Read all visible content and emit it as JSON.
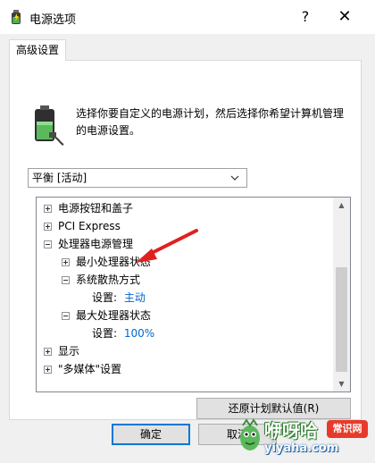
{
  "window": {
    "title": "电源选项",
    "help_label": "?",
    "close_label": "✕"
  },
  "tabs": [
    {
      "label": "高级设置",
      "active": true
    }
  ],
  "intro": {
    "text": "选择你要自定义的电源计划，然后选择你希望计算机管理的电源设置。"
  },
  "plan_select": {
    "value": "平衡 [活动]"
  },
  "tree": {
    "items": [
      {
        "label": "电源按钮和盖子",
        "expander": "plus",
        "level": 0
      },
      {
        "label": "PCI Express",
        "expander": "plus",
        "level": 0
      },
      {
        "label": "处理器电源管理",
        "expander": "minus",
        "level": 0
      },
      {
        "label": "最小处理器状态",
        "expander": "plus",
        "level": 1
      },
      {
        "label": "系统散热方式",
        "expander": "minus",
        "level": 1
      },
      {
        "label": "设置:",
        "value": "主动",
        "expander": "none",
        "level": 2
      },
      {
        "label": "最大处理器状态",
        "expander": "minus",
        "level": 1
      },
      {
        "label": "设置:",
        "value": "100%",
        "expander": "none",
        "level": 2
      },
      {
        "label": "显示",
        "expander": "plus",
        "level": 0
      },
      {
        "label": "\"多媒体\"设置",
        "expander": "plus",
        "level": 0
      }
    ]
  },
  "buttons": {
    "restore": "还原计划默认值(R)",
    "ok": "确定",
    "cancel": "取消"
  },
  "watermark": {
    "text": "咿呀哈",
    "badge": "常识网",
    "url": "yiyaha.com"
  },
  "colors": {
    "setting_value": "#0066cc",
    "annotation_arrow": "#e02020",
    "dialog_bg": "#f0f0f0"
  }
}
